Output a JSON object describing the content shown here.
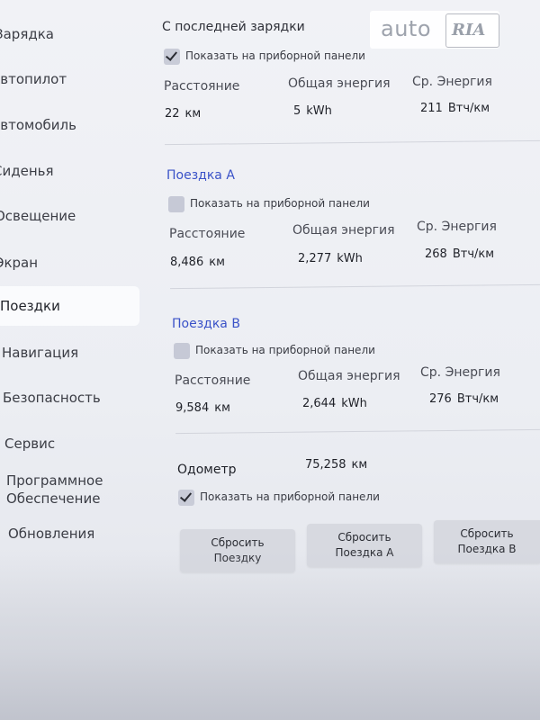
{
  "sidebar": {
    "items": [
      {
        "label": "Зарядка",
        "active": false
      },
      {
        "label": "Автопилот",
        "active": false
      },
      {
        "label": "Автомобиль",
        "active": false
      },
      {
        "label": "Сиденья",
        "active": false
      },
      {
        "label": "Освещение",
        "active": false
      },
      {
        "label": "Экран",
        "active": false
      },
      {
        "label": "Поездки",
        "active": true
      },
      {
        "label": "Навигация",
        "active": false
      },
      {
        "label": "Безопасность",
        "active": false
      },
      {
        "label": "Сервис",
        "active": false
      },
      {
        "label": "Программное",
        "label2": "Обеспечение",
        "active": false
      },
      {
        "label": "Обновления",
        "active": false
      }
    ]
  },
  "since_charge": {
    "title": "С последней зарядки",
    "show_on_dashboard": {
      "label": "Показать на приборной панели",
      "checked": true
    },
    "distance": {
      "label": "Расстояние",
      "value": "22",
      "unit": "км"
    },
    "energy": {
      "label": "Общая энергия",
      "value": "5",
      "unit": "kWh"
    },
    "avg": {
      "label": "Ср. Энергия",
      "value": "211",
      "unit": "Втч/км"
    }
  },
  "trip_a": {
    "title": "Поездка A",
    "show_on_dashboard": {
      "label": "Показать на приборной панели",
      "checked": false
    },
    "distance": {
      "label": "Расстояние",
      "value": "8,486",
      "unit": "км"
    },
    "energy": {
      "label": "Общая энергия",
      "value": "2,277",
      "unit": "kWh"
    },
    "avg": {
      "label": "Ср. Энергия",
      "value": "268",
      "unit": "Втч/км"
    }
  },
  "trip_b": {
    "title": "Поездка B",
    "show_on_dashboard": {
      "label": "Показать на приборной панели",
      "checked": false
    },
    "distance": {
      "label": "Расстояние",
      "value": "9,584",
      "unit": "км"
    },
    "energy": {
      "label": "Общая энергия",
      "value": "2,644",
      "unit": "kWh"
    },
    "avg": {
      "label": "Ср. Энергия",
      "value": "276",
      "unit": "Втч/км"
    }
  },
  "odometer": {
    "label": "Одометр",
    "value": "75,258",
    "unit": "км",
    "show_on_dashboard": {
      "label": "Показать на приборной панели",
      "checked": true
    }
  },
  "buttons": {
    "reset_trip": {
      "line1": "Сбросить",
      "line2": "Поездку"
    },
    "reset_trip_a": {
      "line1": "Сбросить",
      "line2": "Поездка A"
    },
    "reset_trip_b": {
      "line1": "Сбросить",
      "line2": "Поездка B"
    }
  },
  "watermark": {
    "text_left": "auto",
    "text_right": "RIA"
  },
  "colors": {
    "accent": "#3a52c8",
    "background": "#eceef4"
  }
}
